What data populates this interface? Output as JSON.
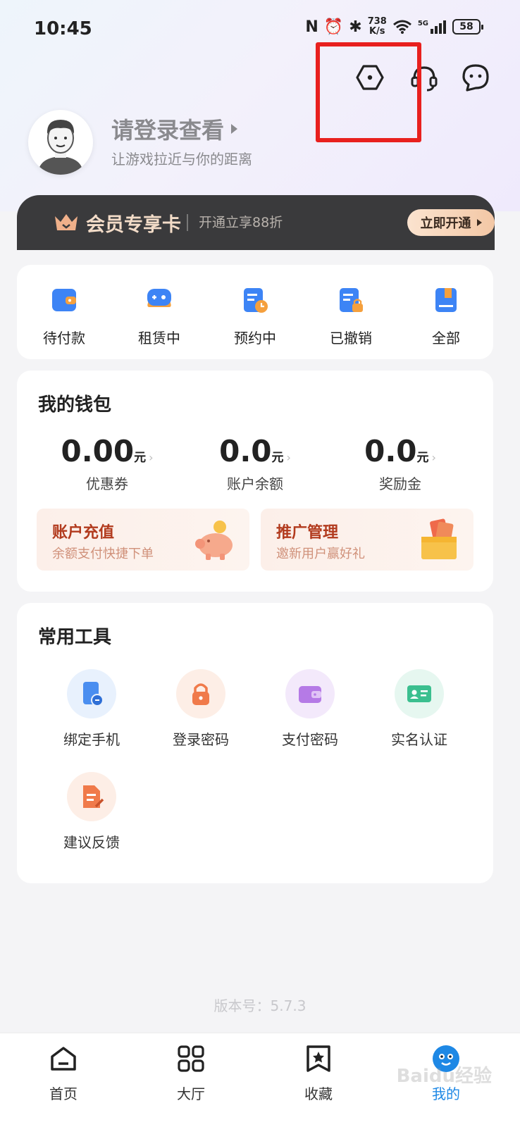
{
  "status_bar": {
    "time": "10:45",
    "net_speed_value": "738",
    "net_speed_unit": "K/s",
    "signal_label": "5G",
    "battery": "58"
  },
  "profile": {
    "login_title": "请登录查看",
    "login_subtitle": "让游戏拉近与你的距离"
  },
  "vip": {
    "title": "会员专享卡",
    "subtitle": "开通立享88折",
    "button": "立即开通"
  },
  "orders": [
    {
      "label": "待付款",
      "icon": "wallet-icon"
    },
    {
      "label": "租赁中",
      "icon": "gamepad-icon"
    },
    {
      "label": "预约中",
      "icon": "clock-doc-icon"
    },
    {
      "label": "已撤销",
      "icon": "lock-doc-icon"
    },
    {
      "label": "全部",
      "icon": "book-icon"
    }
  ],
  "wallet": {
    "title": "我的钱包",
    "items": [
      {
        "value": "0.00",
        "unit": "元",
        "label": "优惠券"
      },
      {
        "value": "0.0",
        "unit": "元",
        "label": "账户余额"
      },
      {
        "value": "0.0",
        "unit": "元",
        "label": "奖励金"
      }
    ],
    "recharge": {
      "title": "账户充值",
      "subtitle": "余额支付快捷下单"
    },
    "promotion": {
      "title": "推广管理",
      "subtitle": "邀新用户赢好礼"
    }
  },
  "tools": {
    "title": "常用工具",
    "items": [
      {
        "label": "绑定手机",
        "icon": "phone-bind-icon",
        "color": "#4a8ef0"
      },
      {
        "label": "登录密码",
        "icon": "lock-icon",
        "color": "#f07a4a"
      },
      {
        "label": "支付密码",
        "icon": "wallet-pay-icon",
        "color": "#b57ae6"
      },
      {
        "label": "实名认证",
        "icon": "id-card-icon",
        "color": "#3bbf8f"
      },
      {
        "label": "建议反馈",
        "icon": "feedback-icon",
        "color": "#f07a4a"
      }
    ]
  },
  "version": "版本号：5.7.3",
  "tabs": [
    {
      "label": "首页",
      "icon": "home-icon"
    },
    {
      "label": "大厅",
      "icon": "grid-icon"
    },
    {
      "label": "收藏",
      "icon": "bookmark-star-icon"
    },
    {
      "label": "我的",
      "icon": "mascot-icon",
      "active": true
    }
  ],
  "watermark": "Baidu经验",
  "colors": {
    "accent": "#1e88e5",
    "highlight": "#e8201e",
    "vip_bg": "#3a3a3c"
  }
}
